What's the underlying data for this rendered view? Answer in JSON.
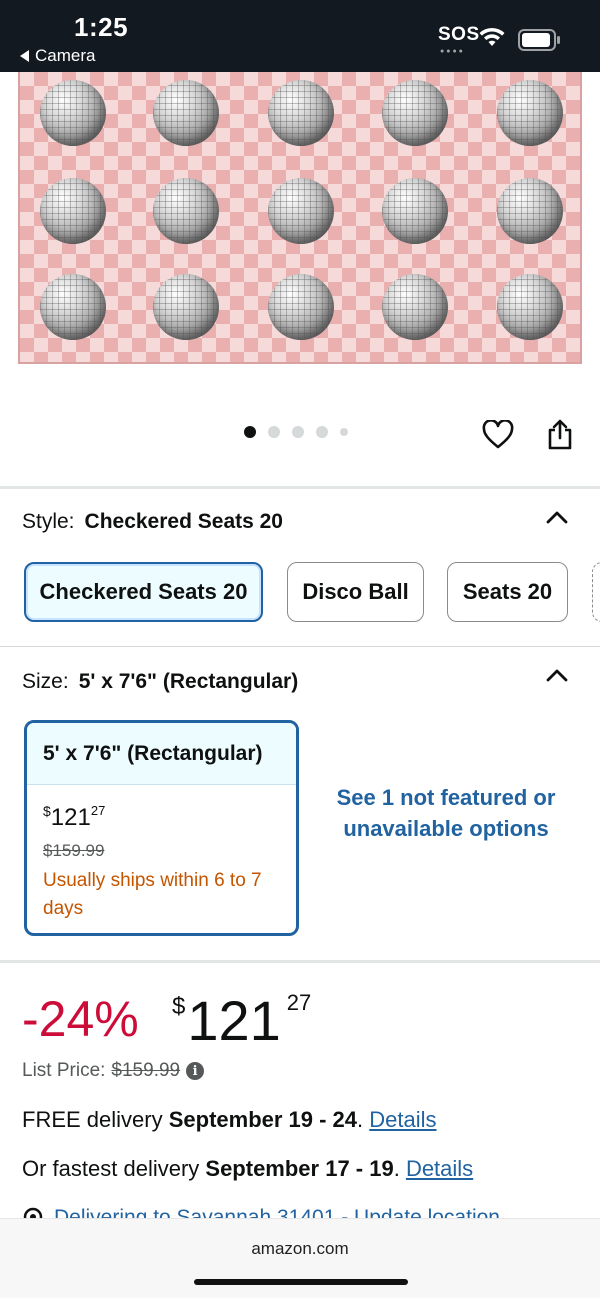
{
  "status_bar": {
    "time": "1:25",
    "back_label": "Camera",
    "sos": "SOS"
  },
  "product": {
    "image_icon": "disco-ball-checkered-rug-image",
    "carousel_total": 5,
    "carousel_active": 1
  },
  "style": {
    "label": "Style:",
    "selected": "Checkered Seats 20",
    "options": [
      "Checkered Seats 20",
      "Disco Ball",
      "Seats 20"
    ]
  },
  "size": {
    "label": "Size:",
    "selected": "5' x 7'6\" (Rectangular)",
    "card": {
      "title": "5' x 7'6\" (Rectangular)",
      "price_currency": "$",
      "price_whole": "121",
      "price_cents": "27",
      "list_price": "$159.99",
      "shipping": "Usually ships within 6 to 7 days"
    },
    "not_featured": "See 1 not featured or unavailable options"
  },
  "price": {
    "discount": "-24%",
    "currency": "$",
    "whole": "121",
    "cents": "27",
    "list_label": "List Price:",
    "list_value": "$159.99"
  },
  "delivery": {
    "free_prefix": "FREE delivery ",
    "free_dates": "September 19 - 24",
    "free_suffix": ". ",
    "details_label": "Details",
    "fast_prefix": "Or fastest delivery ",
    "fast_dates": "September 17 - 19",
    "fast_suffix": ". ",
    "deliver_to": "Delivering to Savannah 31401 - Update location"
  },
  "browser": {
    "url": "amazon.com"
  },
  "colors": {
    "header_bg": "#131921",
    "link": "#2162a1",
    "discount": "#cc0c39",
    "shipping": "#c45500"
  }
}
